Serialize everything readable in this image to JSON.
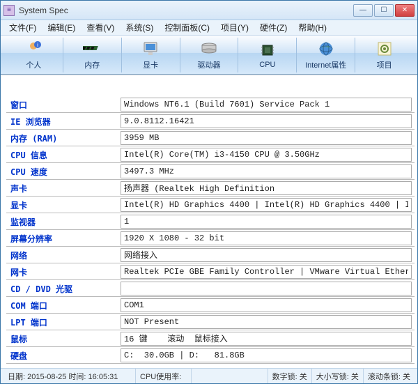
{
  "window": {
    "title": "System Spec"
  },
  "menu": {
    "file": "文件(F)",
    "edit": "编辑(E)",
    "view": "查看(V)",
    "system": "系统(S)",
    "control": "控制面板(C)",
    "project": "项目(Y)",
    "hardware": "硬件(Z)",
    "help": "帮助(H)"
  },
  "toolbar": {
    "personal": "个人",
    "memory": "内存",
    "graphics": "显卡",
    "drives": "驱动器",
    "cpu": "CPU",
    "internet": "Internet属性",
    "project": "项目"
  },
  "rows": [
    {
      "k": "窗口",
      "v": "Windows NT6.1 (Build 7601) Service Pack 1"
    },
    {
      "k": "IE 浏览器",
      "v": "9.0.8112.16421"
    },
    {
      "k": "内存 (RAM)",
      "v": "3959 MB"
    },
    {
      "k": "CPU 信息",
      "v": "Intel(R) Core(TM) i3-4150 CPU @ 3.50GHz"
    },
    {
      "k": "CPU 速度",
      "v": "3497.3 MHz"
    },
    {
      "k": "声卡",
      "v": "扬声器 (Realtek High Definition"
    },
    {
      "k": "显卡",
      "v": "Intel(R) HD Graphics 4400 | Intel(R) HD Graphics 4400 | I"
    },
    {
      "k": "监视器",
      "v": "1"
    },
    {
      "k": "屏幕分辨率",
      "v": "1920 X 1080 - 32 bit"
    },
    {
      "k": "网络",
      "v": "网络接入"
    },
    {
      "k": "网卡",
      "v": "Realtek PCIe GBE Family Controller | VMware Virtual Ether"
    },
    {
      "k": "CD / DVD 光驱",
      "v": ""
    },
    {
      "k": "COM 端口",
      "v": "COM1"
    },
    {
      "k": "LPT 端口",
      "v": "NOT Present"
    },
    {
      "k": "鼠标",
      "v": "16 键    滚动  鼠标接入 "
    },
    {
      "k": "硬盘",
      "v": "C:  30.0GB | D:   81.8GB"
    }
  ],
  "status": {
    "datetime": "日期: 2015-08-25 时间: 16:05:31",
    "cpu_usage": "CPU使用率:",
    "numlock": "数字锁: 关",
    "capslock": "大小写锁: 关",
    "scrolllock": "滚动条锁: 关"
  }
}
